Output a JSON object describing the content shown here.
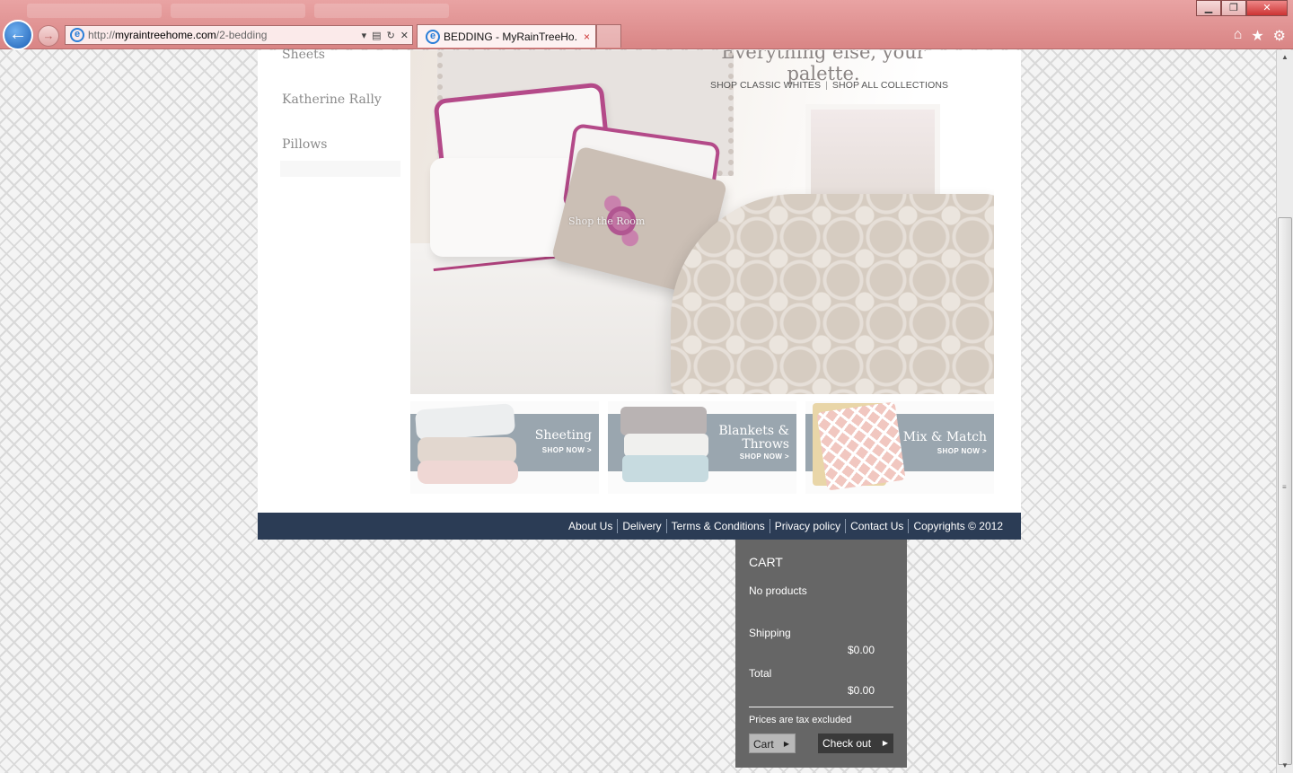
{
  "browser": {
    "url_prefix": "http://",
    "url_domain": "myraintreehome.com",
    "url_path": "/2-bedding",
    "tab_title": "BEDDING - MyRainTreeHo...",
    "tab_close": "×",
    "win_minimize": "▁",
    "win_restore": "❐",
    "win_close": "✕",
    "icons": [
      "back-icon",
      "forward-icon",
      "ie-icon",
      "compat-icon",
      "refresh-icon",
      "stop-icon",
      "home-icon",
      "favorites-icon",
      "settings-icon"
    ]
  },
  "sidebar": {
    "items": [
      {
        "label": "Sheets"
      },
      {
        "label": "Katherine Rally"
      },
      {
        "label": "Pillows"
      }
    ]
  },
  "hero": {
    "headline": "Everything else, your palette.",
    "link_whites": "SHOP CLASSIC WHITES",
    "link_separator": "|",
    "link_all": "SHOP ALL COLLECTIONS",
    "overlay": "Shop the Room"
  },
  "promos": [
    {
      "title_line1": "Sheeting",
      "title_line2": "",
      "cta": "SHOP NOW >"
    },
    {
      "title_line1": "Blankets &",
      "title_line2": "Throws",
      "cta": "SHOP NOW >"
    },
    {
      "title_line1": "Mix & Match",
      "title_line2": "",
      "cta": "SHOP NOW >"
    }
  ],
  "footer": {
    "links": [
      "About Us",
      "Delivery",
      "Terms & Conditions",
      "Privacy policy",
      "Contact Us",
      "Copyrights © 2012"
    ]
  },
  "cart": {
    "title": "CART",
    "empty": "No products",
    "shipping_label": "Shipping",
    "shipping_value": "$0.00",
    "total_label": "Total",
    "total_value": "$0.00",
    "tax_note": "Prices are tax excluded",
    "cart_button": "Cart",
    "checkout_button": "Check out"
  },
  "colors": {
    "footer_bg": "#2b3c55",
    "cart_bg": "#666666",
    "accent_trim": "#b44a89",
    "chrome_tint": "#e19494"
  }
}
